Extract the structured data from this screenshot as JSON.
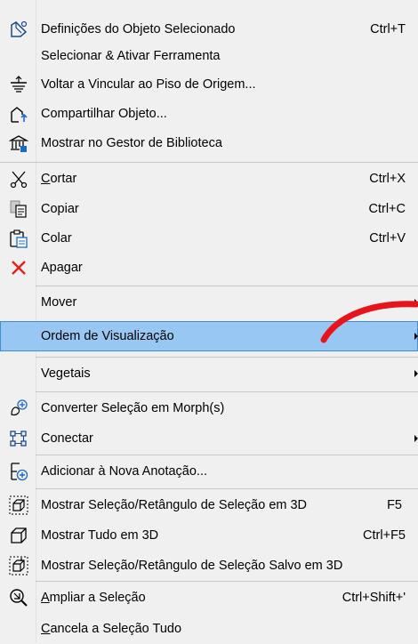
{
  "menu": {
    "items": [
      {
        "label": "Definições do Objeto Selecionado",
        "shortcut": "Ctrl+T"
      },
      {
        "label": "Selecionar & Ativar Ferramenta",
        "shortcut": ""
      },
      {
        "label": "Voltar a Vincular ao Piso de Origem...",
        "shortcut": ""
      },
      {
        "label": "Compartilhar Objeto...",
        "shortcut": ""
      },
      {
        "label": "Mostrar no Gestor de Biblioteca",
        "shortcut": ""
      },
      {
        "label_rest": "ortar",
        "mnemonic": "C",
        "shortcut": "Ctrl+X"
      },
      {
        "label": "Copiar",
        "shortcut": "Ctrl+C"
      },
      {
        "label": "Colar",
        "shortcut": "Ctrl+V"
      },
      {
        "label": "Apagar",
        "shortcut": ""
      },
      {
        "label": "Mover",
        "shortcut": ""
      },
      {
        "label": "Ordem de Visualização",
        "shortcut": ""
      },
      {
        "label": "Vegetais",
        "shortcut": ""
      },
      {
        "label": "Converter Seleção em Morph(s)",
        "shortcut": ""
      },
      {
        "label": "Conectar",
        "shortcut": ""
      },
      {
        "label": "Adicionar à Nova Anotação...",
        "shortcut": ""
      },
      {
        "label": "Mostrar Seleção/Retângulo de Seleção em 3D",
        "shortcut": "F5"
      },
      {
        "label": "Mostrar Tudo em 3D",
        "shortcut": "Ctrl+F5"
      },
      {
        "label": "Mostrar Seleção/Retângulo de Seleção Salvo em 3D",
        "shortcut": ""
      },
      {
        "label_rest": "mpliar a Seleção",
        "mnemonic": "A",
        "shortcut": "Ctrl+Shift+'"
      },
      {
        "label_rest": "ancela a Seleção Tudo",
        "mnemonic": "C",
        "shortcut": ""
      }
    ],
    "icons": {
      "settings": "object-settings-icon",
      "relink": "relink-floor-icon",
      "share": "share-object-icon",
      "library": "library-manager-icon",
      "cut": "scissors-icon",
      "copy": "copy-icon",
      "paste": "paste-icon",
      "delete": "delete-x-icon",
      "morph": "convert-morph-icon",
      "connect": "connect-icon",
      "annotation": "add-annotation-icon",
      "show3d": "show-selection-3d-icon",
      "showall3d": "show-all-3d-icon",
      "showsaved3d": "show-saved-selection-3d-icon",
      "zoom": "zoom-selection-icon"
    },
    "colors": {
      "background": "#f0f0f0",
      "highlight": "#99c7f3",
      "highlight_border": "#3c8ed6",
      "annotation_red": "#e8141c",
      "delete_red": "#e0201a"
    }
  }
}
